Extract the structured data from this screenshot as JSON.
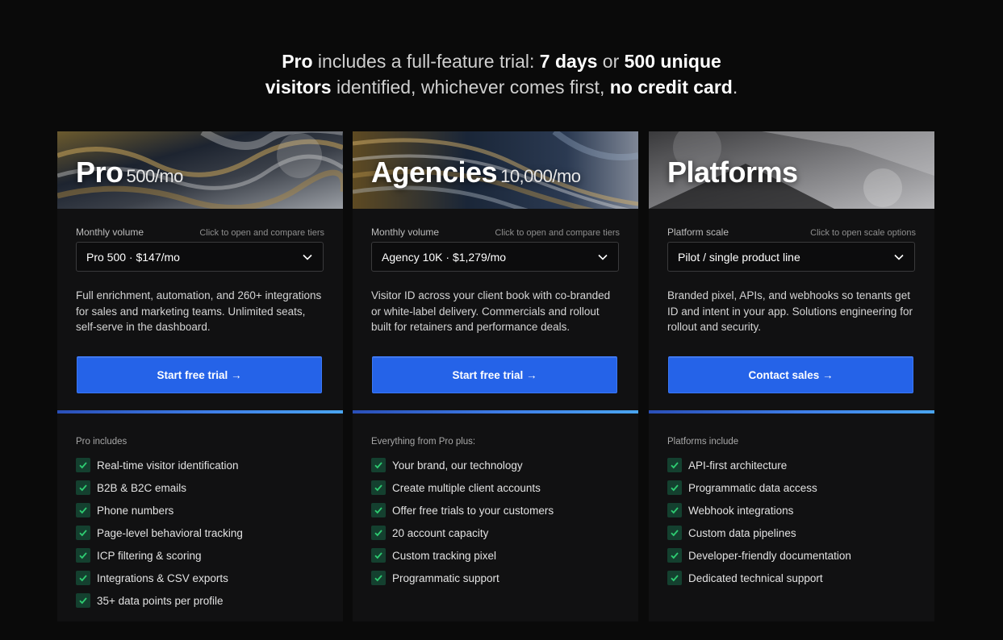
{
  "headline": {
    "line1": [
      {
        "text": "Pro",
        "bold": true
      },
      {
        "text": " includes a full-feature trial: ",
        "bold": false
      },
      {
        "text": "7 days",
        "bold": true
      },
      {
        "text": " or ",
        "bold": false
      },
      {
        "text": "500 unique",
        "bold": true
      }
    ],
    "line2": [
      {
        "text": "visitors",
        "bold": true
      },
      {
        "text": " identified, whichever comes first, ",
        "bold": false
      },
      {
        "text": "no credit card",
        "bold": true
      },
      {
        "text": ".",
        "bold": false
      }
    ]
  },
  "colors": {
    "accent": "#2563e8",
    "background": "#0a0a0a",
    "card": "#111112",
    "check_green": "#2ecc71"
  },
  "cards": [
    {
      "title": "Pro",
      "volume": "500/mo",
      "select_label": "Monthly volume",
      "select_hint": "Click to open and compare tiers",
      "select_value": "Pro 500 · $147/mo",
      "description": "Full enrichment, automation, and 260+ integrations for sales and marketing teams. Unlimited seats, self-serve in the dashboard.",
      "cta": "Start free trial →",
      "includes_label": "Pro includes",
      "features": [
        "Real-time visitor identification",
        "B2B & B2C emails",
        "Phone numbers",
        "Page-level behavioral tracking",
        "ICP filtering & scoring",
        "Integrations & CSV exports",
        "35+ data points per profile"
      ]
    },
    {
      "title": "Agencies",
      "volume": "10,000/mo",
      "select_label": "Monthly volume",
      "select_hint": "Click to open and compare tiers",
      "select_value": "Agency 10K · $1,279/mo",
      "description": "Visitor ID across your client book with co-branded or white-label delivery. Commercials and rollout built for retainers and performance deals.",
      "cta": "Start free trial →",
      "includes_label": "Everything from Pro plus:",
      "features": [
        "Your brand, our technology",
        "Create multiple client accounts",
        "Offer free trials to your customers",
        "20 account capacity",
        "Custom tracking pixel",
        "Programmatic support"
      ]
    },
    {
      "title": "Platforms",
      "volume": "",
      "select_label": "Platform scale",
      "select_hint": "Click to open scale options",
      "select_value": "Pilot / single product line",
      "description": "Branded pixel, APIs, and webhooks so tenants get ID and intent in your app. Solutions engineering for rollout and security.",
      "cta": "Contact sales →",
      "includes_label": "Platforms include",
      "features": [
        "API-first architecture",
        "Programmatic data access",
        "Webhook integrations",
        "Custom data pipelines",
        "Developer-friendly documentation",
        "Dedicated technical support"
      ]
    }
  ]
}
